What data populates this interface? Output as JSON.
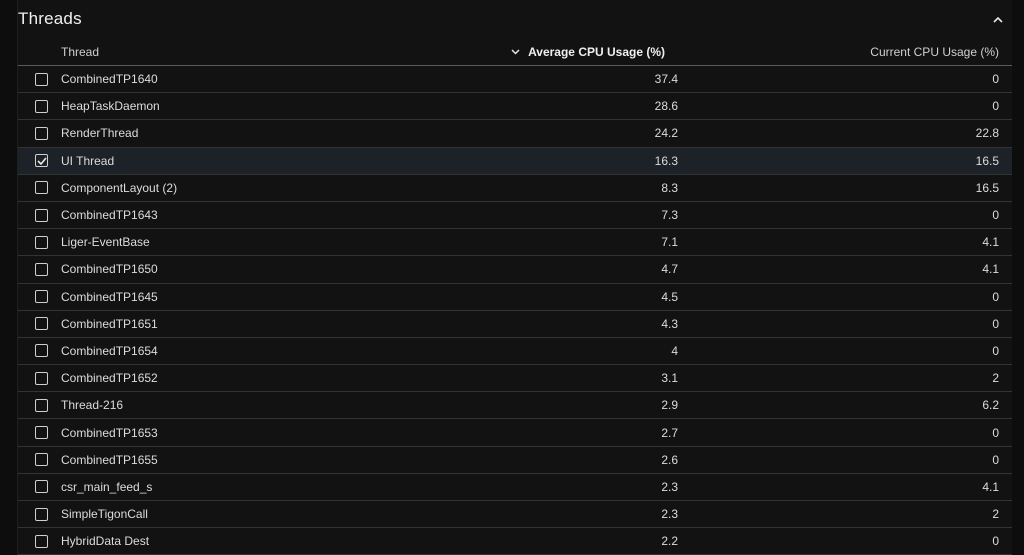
{
  "panel": {
    "title": "Threads"
  },
  "table": {
    "columns": {
      "thread": "Thread",
      "avg": "Average CPU Usage (%)",
      "current": "Current CPU Usage (%)"
    },
    "sort_icon": "chevron-down-icon",
    "rows": [
      {
        "name": "CombinedTP1640",
        "avg": "37.4",
        "current": "0",
        "checked": false
      },
      {
        "name": "HeapTaskDaemon",
        "avg": "28.6",
        "current": "0",
        "checked": false
      },
      {
        "name": "RenderThread",
        "avg": "24.2",
        "current": "22.8",
        "checked": false
      },
      {
        "name": "UI Thread",
        "avg": "16.3",
        "current": "16.5",
        "checked": true
      },
      {
        "name": "ComponentLayout (2)",
        "avg": "8.3",
        "current": "16.5",
        "checked": false
      },
      {
        "name": "CombinedTP1643",
        "avg": "7.3",
        "current": "0",
        "checked": false
      },
      {
        "name": "Liger-EventBase",
        "avg": "7.1",
        "current": "4.1",
        "checked": false
      },
      {
        "name": "CombinedTP1650",
        "avg": "4.7",
        "current": "4.1",
        "checked": false
      },
      {
        "name": "CombinedTP1645",
        "avg": "4.5",
        "current": "0",
        "checked": false
      },
      {
        "name": "CombinedTP1651",
        "avg": "4.3",
        "current": "0",
        "checked": false
      },
      {
        "name": "CombinedTP1654",
        "avg": "4",
        "current": "0",
        "checked": false
      },
      {
        "name": "CombinedTP1652",
        "avg": "3.1",
        "current": "2",
        "checked": false
      },
      {
        "name": "Thread-216",
        "avg": "2.9",
        "current": "6.2",
        "checked": false
      },
      {
        "name": "CombinedTP1653",
        "avg": "2.7",
        "current": "0",
        "checked": false
      },
      {
        "name": "CombinedTP1655",
        "avg": "2.6",
        "current": "0",
        "checked": false
      },
      {
        "name": "csr_main_feed_s",
        "avg": "2.3",
        "current": "4.1",
        "checked": false
      },
      {
        "name": "SimpleTigonCall",
        "avg": "2.3",
        "current": "2",
        "checked": false
      },
      {
        "name": "HybridData Dest",
        "avg": "2.2",
        "current": "0",
        "checked": false
      }
    ]
  },
  "colors": {
    "background": "#121212",
    "selected_row": "#1d2128",
    "divider": "#333333"
  }
}
